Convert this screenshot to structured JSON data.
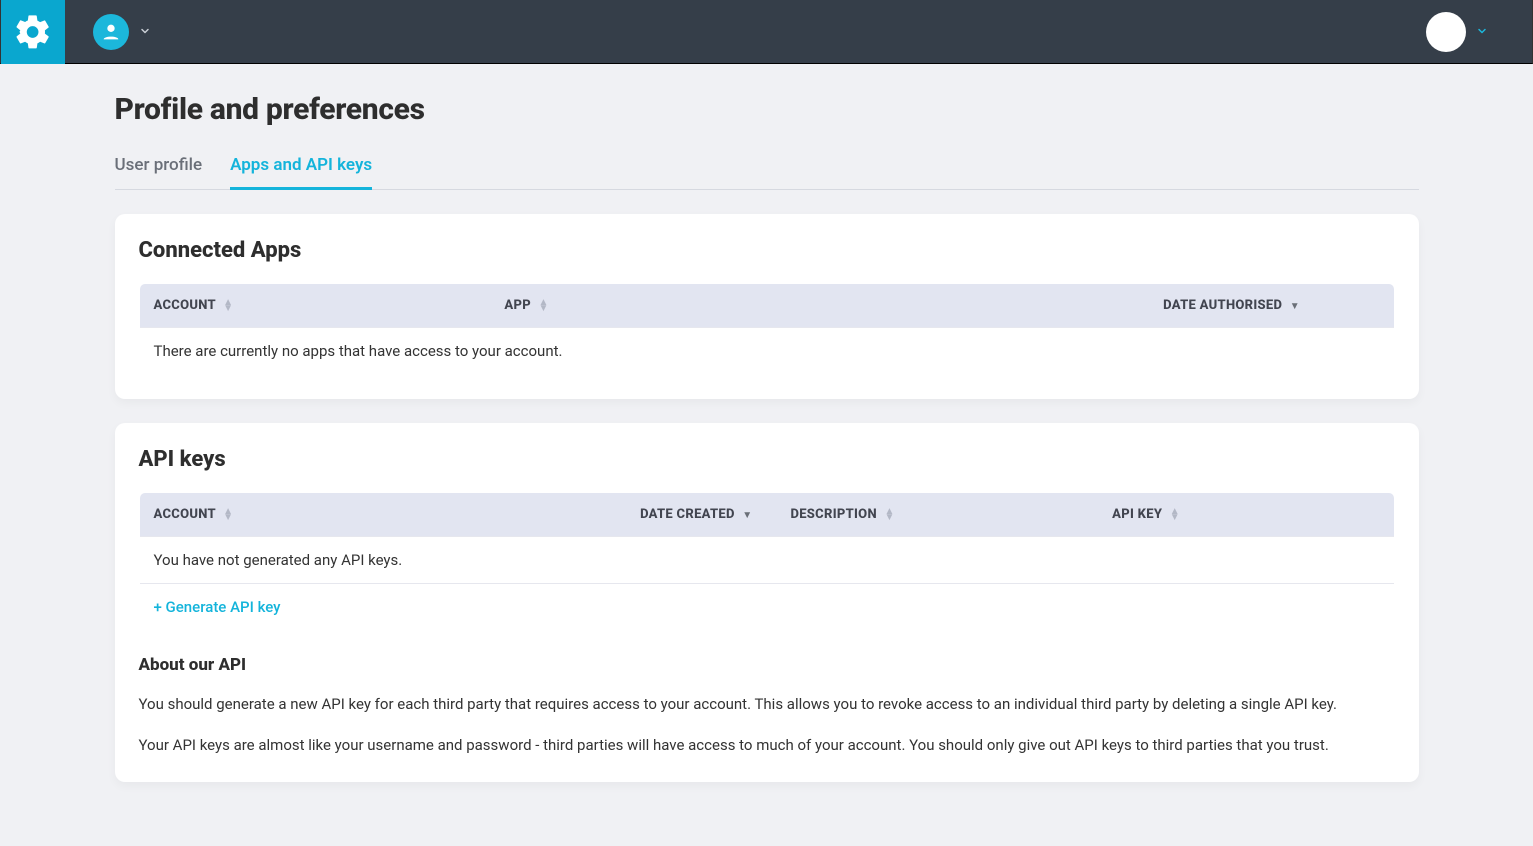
{
  "header": {
    "title": "Profile and preferences"
  },
  "tabs": [
    {
      "label": "User profile",
      "active": false
    },
    {
      "label": "Apps and API keys",
      "active": true
    }
  ],
  "connected_apps": {
    "heading": "Connected Apps",
    "columns": {
      "account": "ACCOUNT",
      "app": "APP",
      "date_authorised": "DATE AUTHORISED"
    },
    "empty": "There are currently no apps that have access to your account."
  },
  "api_keys": {
    "heading": "API keys",
    "columns": {
      "account": "ACCOUNT",
      "date_created": "DATE CREATED",
      "description": "DESCRIPTION",
      "api_key": "API KEY"
    },
    "empty": "You have not generated any API keys.",
    "generate_label": "+ Generate API key",
    "about": {
      "heading": "About our API",
      "p1": "You should generate a new API key for each third party that requires access to your account. This allows you to revoke access to an individual third party by deleting a single API key.",
      "p2": "Your API keys are almost like your username and password - third parties will have access to much of your account. You should only give out API keys to third parties that you trust."
    }
  }
}
